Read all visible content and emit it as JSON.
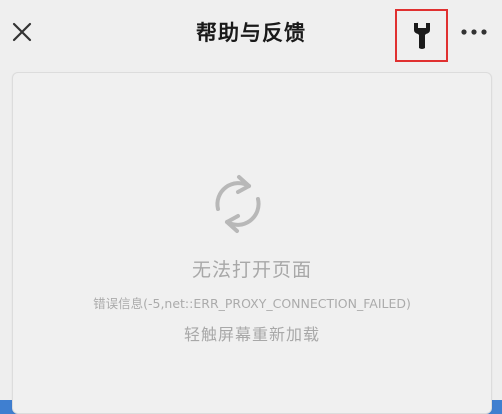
{
  "header": {
    "title": "帮助与反馈",
    "close_icon": "close-icon",
    "wrench_icon": "wrench-icon",
    "more_icon": "more-horizontal-icon",
    "highlight_color": "#e03030"
  },
  "error_page": {
    "reload_icon": "reload-icon",
    "title": "无法打开页面",
    "detail": "错误信息(-5,net::ERR_PROXY_CONNECTION_FAILED)",
    "hint": "轻触屏幕重新加载"
  }
}
